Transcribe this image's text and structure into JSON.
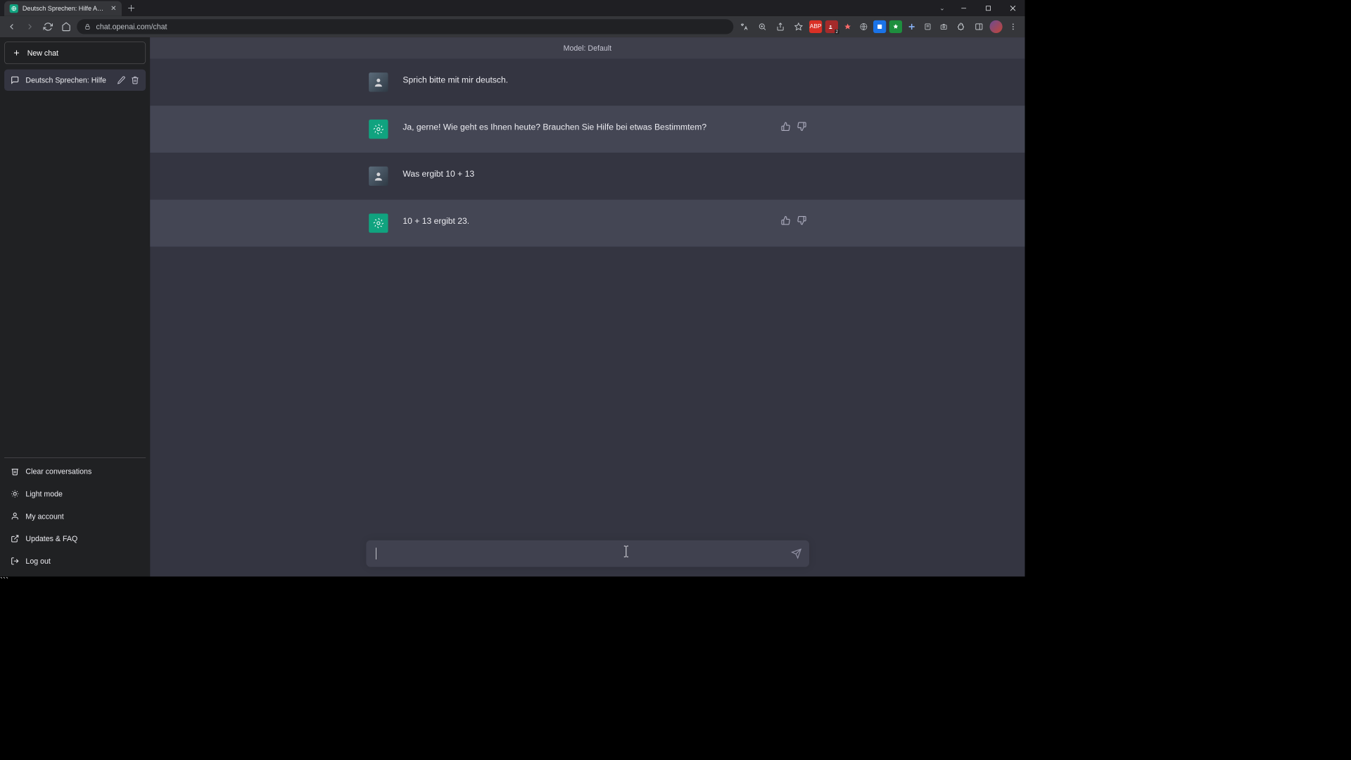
{
  "window": {
    "tab_title": "Deutsch Sprechen: Hilfe Angebo",
    "url": "chat.openai.com/chat"
  },
  "sidebar": {
    "new_chat_label": "New chat",
    "conversations": [
      {
        "title": "Deutsch Sprechen: Hilfe"
      }
    ],
    "footer": {
      "clear": "Clear conversations",
      "light_mode": "Light mode",
      "account": "My account",
      "updates": "Updates & FAQ",
      "logout": "Log out"
    }
  },
  "main": {
    "model_label": "Model: Default",
    "input_placeholder": ""
  },
  "messages": [
    {
      "role": "user",
      "text": "Sprich bitte mit mir deutsch."
    },
    {
      "role": "assistant",
      "text": "Ja, gerne! Wie geht es Ihnen heute? Brauchen Sie Hilfe bei etwas Bestimmtem?"
    },
    {
      "role": "user",
      "text": "Was ergibt 10 + 13"
    },
    {
      "role": "assistant",
      "text": "10 + 13 ergibt 23."
    }
  ]
}
